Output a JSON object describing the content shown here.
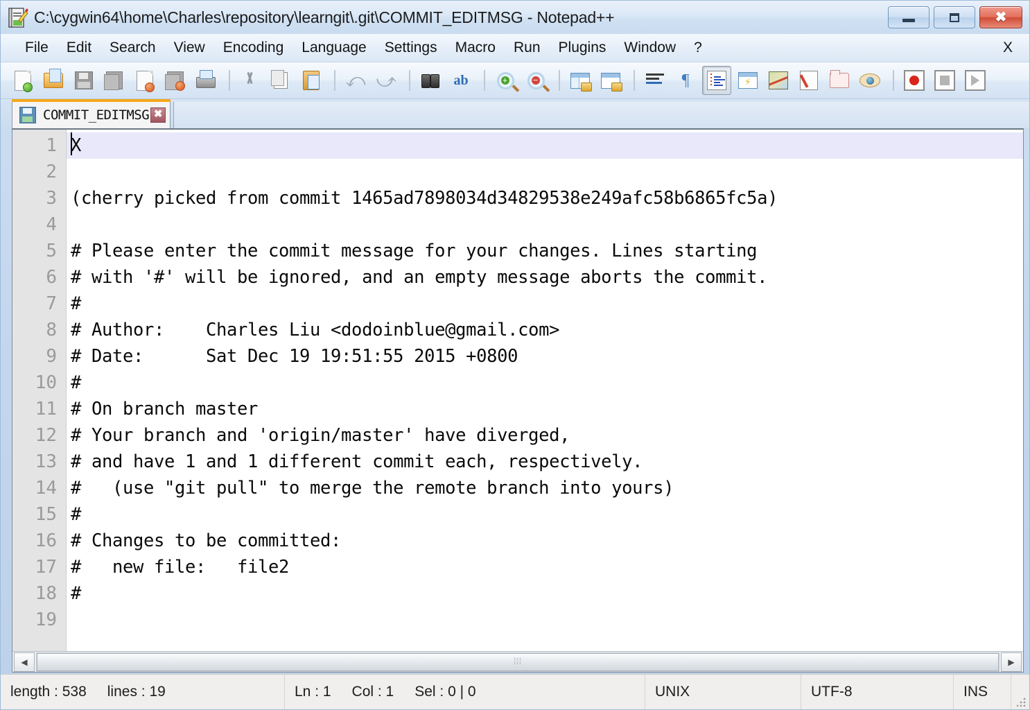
{
  "window": {
    "title": "C:\\cygwin64\\home\\Charles\\repository\\learngit\\.git\\COMMIT_EDITMSG - Notepad++",
    "icon": "notepad-plus-plus-icon",
    "buttons": {
      "minimize": "minimize-icon",
      "maximize": "maximize-icon",
      "close": "✖"
    }
  },
  "menu": {
    "items": [
      {
        "label": "File"
      },
      {
        "label": "Edit"
      },
      {
        "label": "Search"
      },
      {
        "label": "View"
      },
      {
        "label": "Encoding"
      },
      {
        "label": "Language"
      },
      {
        "label": "Settings"
      },
      {
        "label": "Macro"
      },
      {
        "label": "Run"
      },
      {
        "label": "Plugins"
      },
      {
        "label": "Window"
      },
      {
        "label": "?"
      }
    ],
    "close_document_label": "X"
  },
  "toolbar": {
    "groups": [
      [
        "new-file-icon",
        "open-file-icon",
        "save-icon",
        "save-all-icon",
        "close-file-icon",
        "close-all-files-icon",
        "print-icon"
      ],
      [
        "cut-icon",
        "copy-icon",
        "paste-icon"
      ],
      [
        "undo-icon",
        "redo-icon"
      ],
      [
        "find-icon",
        "replace-icon"
      ],
      [
        "zoom-in-icon",
        "zoom-out-icon"
      ],
      [
        "sync-vertical-scrolling-icon",
        "sync-horizontal-scrolling-icon"
      ],
      [
        "word-wrap-icon",
        "show-all-characters-icon"
      ],
      [
        "show-indent-guide-icon",
        "user-defined-dialog-icon",
        "document-map-icon",
        "function-list-icon",
        "folder-as-workspace-icon",
        "monitoring-icon"
      ],
      [
        "start-recording-icon",
        "stop-recording-icon",
        "playback-icon"
      ]
    ],
    "pressed": "show-indent-guide-icon"
  },
  "tabs": [
    {
      "label": "COMMIT_EDITMSG",
      "icon": "saved-file-icon",
      "close": "✖",
      "active": true
    }
  ],
  "editor": {
    "caret_line": 1,
    "lines": [
      {
        "n": "1",
        "text": "X"
      },
      {
        "n": "2",
        "text": ""
      },
      {
        "n": "3",
        "text": "(cherry picked from commit 1465ad7898034d34829538e249afc58b6865fc5a)"
      },
      {
        "n": "4",
        "text": ""
      },
      {
        "n": "5",
        "text": "# Please enter the commit message for your changes. Lines starting"
      },
      {
        "n": "6",
        "text": "# with '#' will be ignored, and an empty message aborts the commit."
      },
      {
        "n": "7",
        "text": "#"
      },
      {
        "n": "8",
        "text": "# Author:    Charles Liu <dodoinblue@gmail.com>"
      },
      {
        "n": "9",
        "text": "# Date:      Sat Dec 19 19:51:55 2015 +0800"
      },
      {
        "n": "10",
        "text": "#"
      },
      {
        "n": "11",
        "text": "# On branch master"
      },
      {
        "n": "12",
        "text": "# Your branch and 'origin/master' have diverged,"
      },
      {
        "n": "13",
        "text": "# and have 1 and 1 different commit each, respectively."
      },
      {
        "n": "14",
        "text": "#   (use \"git pull\" to merge the remote branch into yours)"
      },
      {
        "n": "15",
        "text": "#"
      },
      {
        "n": "16",
        "text": "# Changes to be committed:"
      },
      {
        "n": "17",
        "text": "#   new file:   file2"
      },
      {
        "n": "18",
        "text": "#"
      },
      {
        "n": "19",
        "text": ""
      }
    ]
  },
  "hscrollbar": {
    "left_arrow": "◀",
    "right_arrow": "▶",
    "grip": "⦙⦙⦙"
  },
  "statusbar": {
    "length_label": "length : 538",
    "lines_label": "lines : 19",
    "ln_label": "Ln : 1",
    "col_label": "Col : 1",
    "sel_label": "Sel : 0 | 0",
    "eol_label": "UNIX",
    "encoding_label": "UTF-8",
    "insert_mode_label": "INS"
  },
  "colors": {
    "tab_active_accent": "#f5a81c",
    "current_line_highlight": "#e8e8fa",
    "gutter_bg": "#e4e4e4",
    "window_chrome": "#cfe0f2"
  }
}
